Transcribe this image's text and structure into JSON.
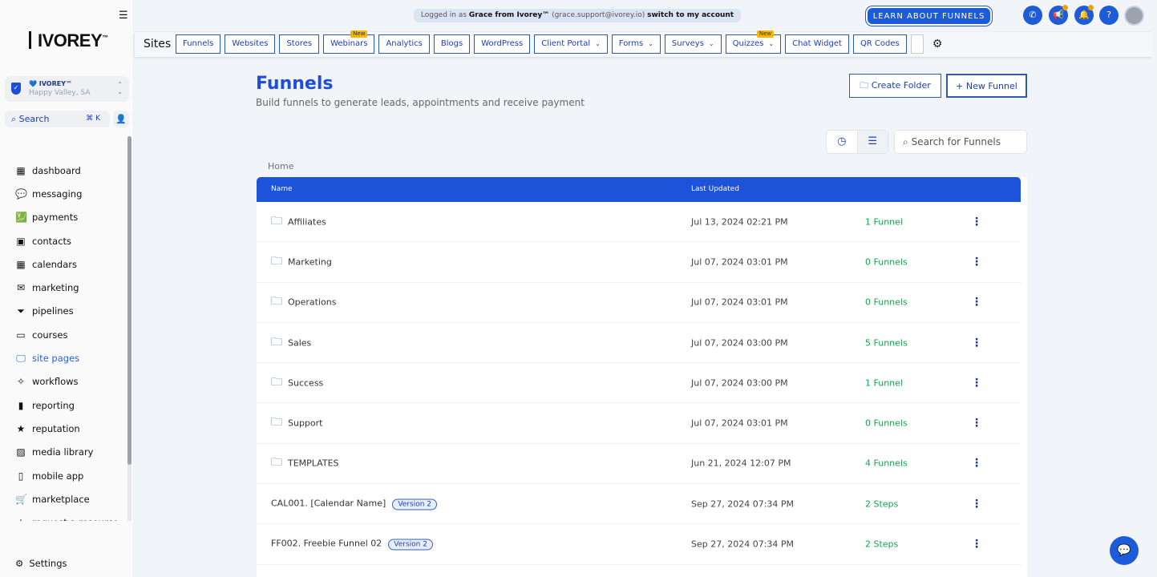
{
  "sidebar": {
    "logo": "IVOREY",
    "logo_tm": "™",
    "account": {
      "name": "💙 IVOREY™",
      "location": "Happy Valley, SA"
    },
    "search": {
      "label": "Search",
      "shortcut": "⌘ K"
    },
    "items": [
      {
        "label": "dashboard",
        "icon": "grid-icon"
      },
      {
        "label": "messaging",
        "icon": "chat-icon"
      },
      {
        "label": "payments",
        "icon": "payments-icon"
      },
      {
        "label": "contacts",
        "icon": "contact-book-icon"
      },
      {
        "label": "calendars",
        "icon": "calendar-icon"
      },
      {
        "label": "marketing",
        "icon": "envelope-icon"
      },
      {
        "label": "pipelines",
        "icon": "funnel-icon"
      },
      {
        "label": "courses",
        "icon": "courses-icon"
      },
      {
        "label": "site pages",
        "icon": "monitor-icon",
        "active": true
      },
      {
        "label": "workflows",
        "icon": "magic-wand-icon"
      },
      {
        "label": "reporting",
        "icon": "bar-chart-icon"
      },
      {
        "label": "reputation",
        "icon": "star-icon"
      },
      {
        "label": "media library",
        "icon": "image-icon"
      },
      {
        "label": "mobile app",
        "icon": "phone-icon"
      },
      {
        "label": "marketplace",
        "icon": "cart-icon"
      },
      {
        "label": "request a resource",
        "icon": "plus-icon"
      }
    ],
    "settings": "Settings"
  },
  "topbar": {
    "banner": {
      "prefix": "Logged in as",
      "user": "Grace from Ivorey™",
      "email": "(grace.support@ivorey.io)",
      "switch": "switch to my account"
    },
    "learn": "LEARN ABOUT FUNNELS",
    "help": "?"
  },
  "tabbar": {
    "title": "Sites",
    "tabs": [
      {
        "label": "Funnels"
      },
      {
        "label": "Websites"
      },
      {
        "label": "Stores"
      },
      {
        "label": "Webinars",
        "badge": "New"
      },
      {
        "label": "Analytics"
      },
      {
        "label": "Blogs"
      },
      {
        "label": "WordPress"
      },
      {
        "label": "Client Portal",
        "dropdown": true
      },
      {
        "label": "Forms",
        "dropdown": true
      },
      {
        "label": "Surveys",
        "dropdown": true
      },
      {
        "label": "Quizzes",
        "dropdown": true,
        "badge": "New"
      },
      {
        "label": "Chat Widget"
      },
      {
        "label": "QR Codes"
      }
    ]
  },
  "page": {
    "title": "Funnels",
    "subtitle": "Build funnels to generate leads, appointments and receive payment",
    "create_folder": "Create Folder",
    "new_funnel": "New Funnel",
    "search_placeholder": "Search for Funnels",
    "breadcrumb": "Home"
  },
  "table": {
    "columns": [
      "Name",
      "Last Updated"
    ],
    "rows": [
      {
        "name": "Affiliates",
        "type": "folder",
        "updated": "Jul 13, 2024 02:21 PM",
        "count": "1 Funnel"
      },
      {
        "name": "Marketing",
        "type": "folder",
        "updated": "Jul 07, 2024 03:01 PM",
        "count": "0 Funnels"
      },
      {
        "name": "Operations",
        "type": "folder",
        "updated": "Jul 07, 2024 03:01 PM",
        "count": "0 Funnels"
      },
      {
        "name": "Sales",
        "type": "folder",
        "updated": "Jul 07, 2024 03:00 PM",
        "count": "5 Funnels"
      },
      {
        "name": "Success",
        "type": "folder",
        "updated": "Jul 07, 2024 03:00 PM",
        "count": "1 Funnel"
      },
      {
        "name": "Support",
        "type": "folder",
        "updated": "Jul 07, 2024 03:01 PM",
        "count": "0 Funnels"
      },
      {
        "name": "TEMPLATES",
        "type": "folder",
        "updated": "Jun 21, 2024 12:07 PM",
        "count": "4 Funnels"
      },
      {
        "name": "CAL001. [Calendar Name]",
        "type": "funnel",
        "badge": "Version 2",
        "updated": "Sep 27, 2024 07:34 PM",
        "count": "2 Steps"
      },
      {
        "name": "FF002. Freebie Funnel 02",
        "type": "funnel",
        "badge": "Version 2",
        "updated": "Sep 27, 2024 07:34 PM",
        "count": "2 Steps"
      }
    ]
  },
  "colors": {
    "accent": "#1d53d8",
    "count_green": "#16a34a",
    "active_nav": "#2563eb",
    "new_badge": "#f5b800"
  }
}
